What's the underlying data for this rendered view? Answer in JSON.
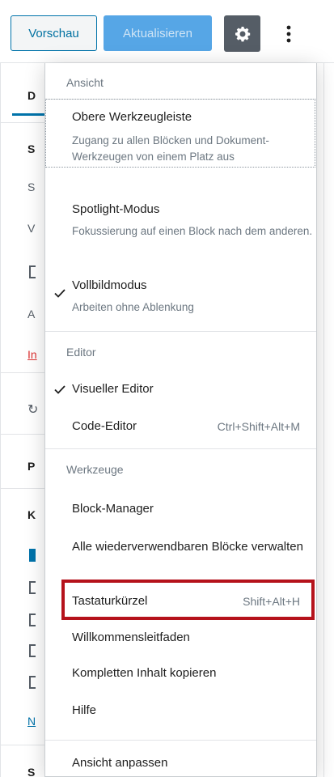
{
  "toolbar": {
    "preview_label": "Vorschau",
    "update_label": "Aktualisieren"
  },
  "sidebar_bg": {
    "letters": [
      "D",
      "S",
      "S",
      "V",
      "A",
      "In",
      "P",
      "K",
      "N",
      "S"
    ]
  },
  "menu": {
    "view": {
      "label": "Ansicht",
      "top_toolbar": {
        "title": "Obere Werkzeugleiste",
        "desc": "Zugang zu allen Blöcken und Dokument-Werkzeugen von einem Platz aus"
      },
      "spotlight": {
        "title": "Spotlight-Modus",
        "desc": "Fokussierung auf einen Block nach dem anderen."
      },
      "fullscreen": {
        "title": "Vollbildmodus",
        "desc": "Arbeiten ohne Ablenkung",
        "checked": true
      }
    },
    "editor": {
      "label": "Editor",
      "visual": {
        "title": "Visueller Editor",
        "checked": true
      },
      "code": {
        "title": "Code-Editor",
        "shortcut": "Ctrl+Shift+Alt+M"
      }
    },
    "tools": {
      "label": "Werkzeuge",
      "block_manager": "Block-Manager",
      "reusable": "Alle wiederverwendbaren Blöcke verwalten",
      "keyboard": {
        "title": "Tastaturkürzel",
        "shortcut": "Shift+Alt+H"
      },
      "welcome": "Willkommensleitfaden",
      "copy_all": "Kompletten Inhalt kopieren",
      "help": "Hilfe"
    },
    "customize": "Ansicht anpassen"
  },
  "colors": {
    "accent": "#0073aa",
    "update_button": "#56a6e6",
    "settings_button": "#555d66",
    "highlight": "#b5121b"
  },
  "icons": [
    "gear-icon",
    "more-vertical-icon",
    "check-icon"
  ]
}
